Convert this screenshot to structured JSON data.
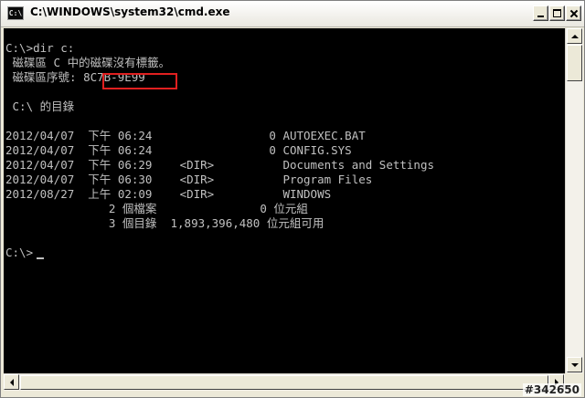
{
  "window": {
    "title": "C:\\WINDOWS\\system32\\cmd.exe",
    "icon_label": "C:\\"
  },
  "colors": {
    "console_bg": "#000000",
    "console_fg": "#c0c0c0",
    "highlight": "#e02020"
  },
  "console": {
    "lines": [
      "C:\\>dir c:",
      " 磁碟區 C 中的磁碟沒有標籤。",
      " 磁碟區序號: 8C7B-9E99",
      "",
      " C:\\ 的目錄",
      "",
      "2012/04/07  下午 06:24                 0 AUTOEXEC.BAT",
      "2012/04/07  下午 06:24                 0 CONFIG.SYS",
      "2012/04/07  下午 06:29    <DIR>          Documents and Settings",
      "2012/04/07  下午 06:30    <DIR>          Program Files",
      "2012/08/27  上午 02:09    <DIR>          WINDOWS",
      "               2 個檔案               0 位元組",
      "               3 個目錄  1,893,396,480 位元組可用",
      "",
      "C:\\>"
    ],
    "volume_serial": "8C7B-9E99"
  },
  "watermark": "#342650"
}
